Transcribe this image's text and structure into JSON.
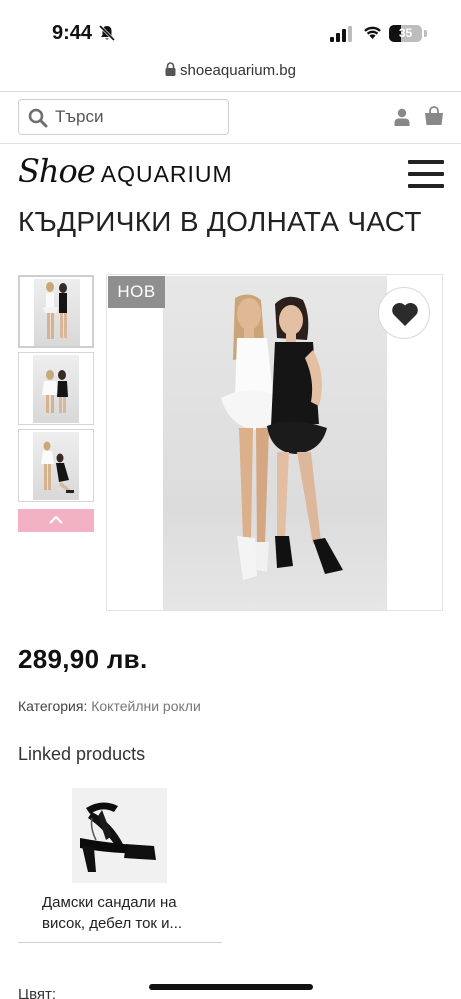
{
  "status_bar": {
    "time": "9:44",
    "battery_level": "35",
    "battery_fraction": 0.35
  },
  "browser": {
    "url": "shoeaquarium.bg"
  },
  "header": {
    "search_placeholder": "Търси",
    "logo_script": "Shoe",
    "logo_caps": "AQUARIUM"
  },
  "product": {
    "title": "КЪДРИЧКИ В ДОЛНАТА ЧАСТ",
    "badge": "НОВ",
    "price": "289,90 лв.",
    "category_label": "Категория:",
    "category_value": "Коктейлни рокли",
    "color_label": "Цвят:"
  },
  "linked": {
    "heading": "Linked products",
    "items": [
      {
        "name": "Дамски сандали на висок, дебел ток и..."
      }
    ]
  },
  "icons": {
    "silent": "bell-slash-icon",
    "signal": "cellular-signal-icon",
    "wifi": "wifi-icon",
    "lock": "lock-icon",
    "search": "search-icon",
    "user": "user-icon",
    "bag": "shopping-bag-icon",
    "menu": "hamburger-menu-icon",
    "wishlist": "heart-icon",
    "up": "chevron-up-icon"
  },
  "colors": {
    "badge_bg": "#8f8f8f",
    "thumb_nav_bg": "#f3b2c3",
    "text": "#222222",
    "icon_gray": "#888888"
  }
}
